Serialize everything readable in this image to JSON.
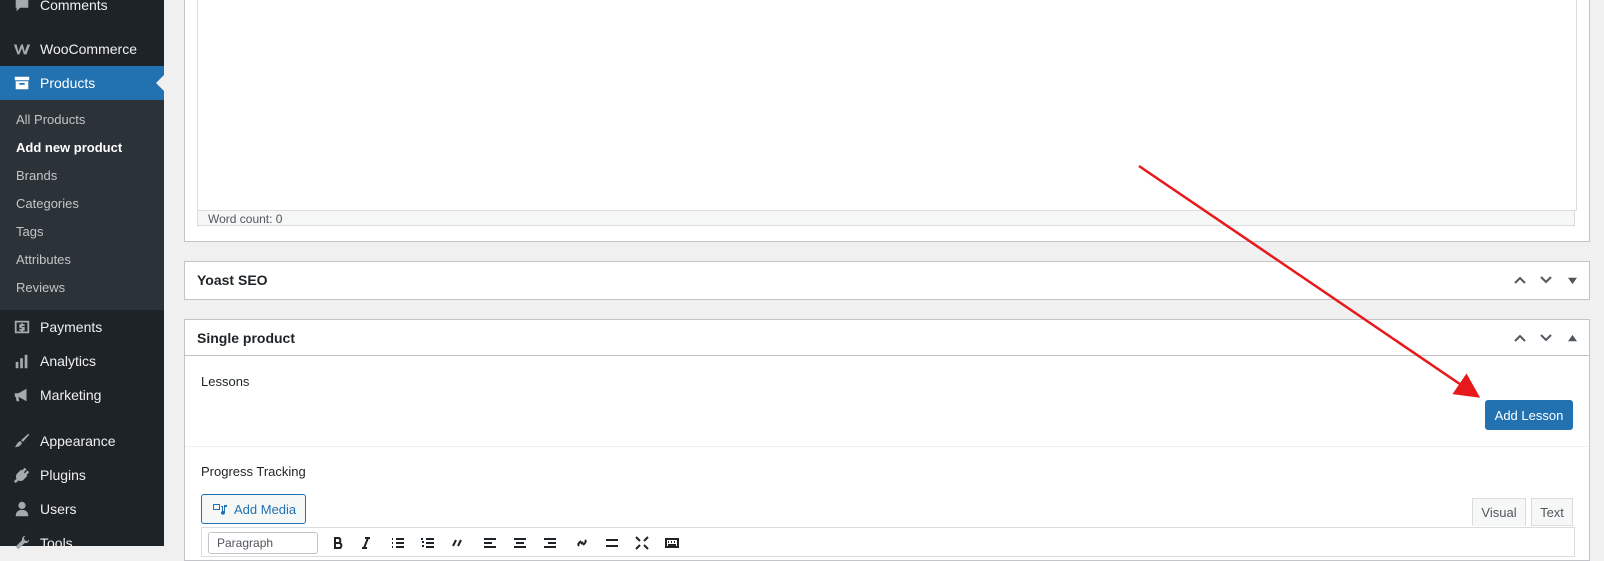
{
  "sidebar": {
    "menu": [
      {
        "label": "Comments"
      },
      {
        "label": "WooCommerce"
      },
      {
        "label": "Products"
      },
      {
        "label": "Payments"
      },
      {
        "label": "Analytics"
      },
      {
        "label": "Marketing"
      },
      {
        "label": "Appearance"
      },
      {
        "label": "Plugins"
      },
      {
        "label": "Users"
      },
      {
        "label": "Tools"
      }
    ],
    "submenu": [
      {
        "label": "All Products"
      },
      {
        "label": "Add new product"
      },
      {
        "label": "Brands"
      },
      {
        "label": "Categories"
      },
      {
        "label": "Tags"
      },
      {
        "label": "Attributes"
      },
      {
        "label": "Reviews"
      }
    ],
    "active_item": "Products",
    "current_subitem": "Add new product"
  },
  "editor": {
    "word_count": "Word count: 0"
  },
  "yoast": {
    "title": "Yoast SEO"
  },
  "single_product": {
    "title": "Single product",
    "lessons_label": "Lessons",
    "add_lesson_button": "Add Lesson",
    "progress_label": "Progress Tracking",
    "add_media_button": "Add Media",
    "tab_visual": "Visual",
    "tab_text": "Text",
    "format_select": "Paragraph"
  },
  "colors": {
    "sidebar_bg": "#1d2327",
    "submenu_bg": "#2c3338",
    "accent": "#2271b1",
    "annotation_arrow": "#e8191b"
  }
}
